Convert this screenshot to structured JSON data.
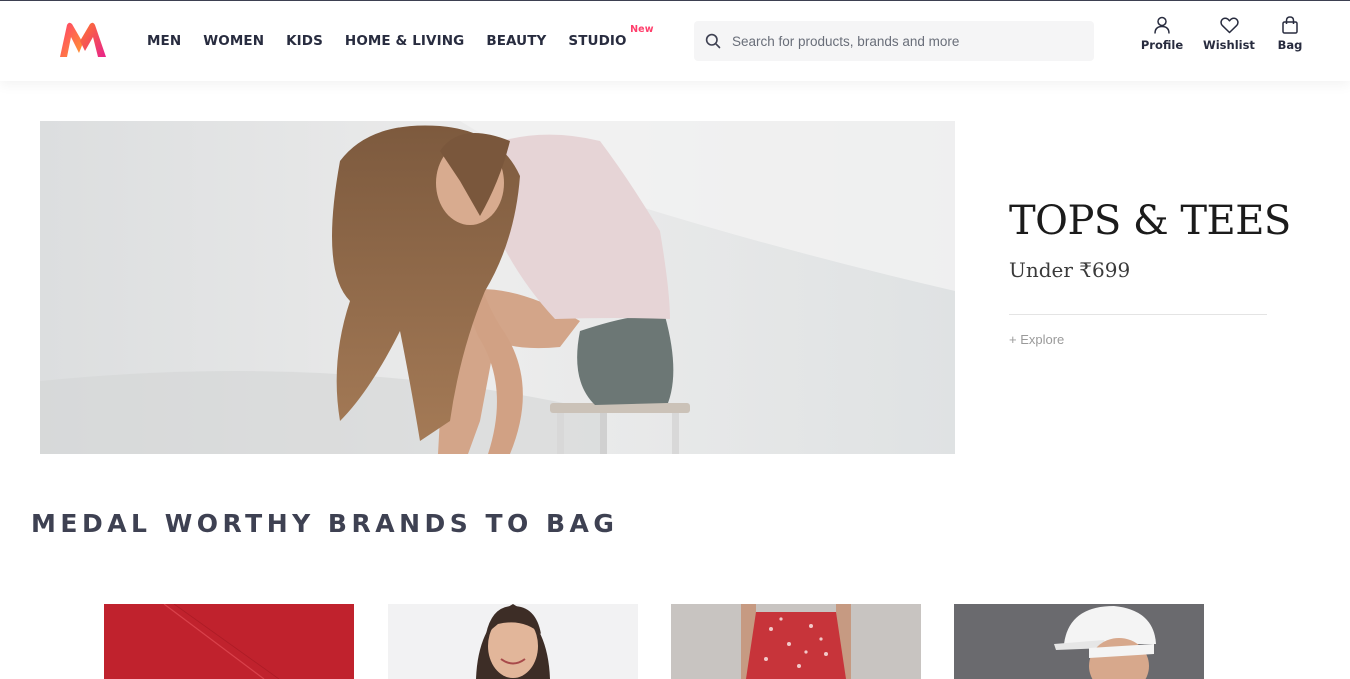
{
  "header": {
    "logo": {
      "icon": "myntra-logo-icon",
      "colors": [
        "#ff3f6c",
        "#ff7f23",
        "#e8228c"
      ]
    },
    "nav": [
      {
        "label": "MEN"
      },
      {
        "label": "WOMEN"
      },
      {
        "label": "KIDS"
      },
      {
        "label": "HOME & LIVING"
      },
      {
        "label": "BEAUTY"
      },
      {
        "label": "STUDIO",
        "badge": "New"
      }
    ],
    "search": {
      "icon": "search-icon",
      "placeholder": "Search for products, brands and more",
      "value": ""
    },
    "actions": [
      {
        "label": "Profile",
        "icon": "profile-icon"
      },
      {
        "label": "Wishlist",
        "icon": "heart-icon"
      },
      {
        "label": "Bag",
        "icon": "bag-icon"
      }
    ]
  },
  "hero": {
    "image": "woman-sitting-on-stool-photo",
    "promo": {
      "title": "TOPS & TEES",
      "subtitle": "Under ₹699",
      "cta": "+ Explore"
    }
  },
  "section": {
    "title": "MEDAL WORTHY BRANDS TO BAG",
    "cards": [
      {
        "image": "red-brand-banner"
      },
      {
        "image": "woman-smiling-model"
      },
      {
        "image": "red-floral-skirt-model"
      },
      {
        "image": "man-white-cap-model"
      }
    ]
  },
  "colors": {
    "accent": "#ff3f6c",
    "text": "#282c3f",
    "heading": "#3e4152",
    "search_bg": "#f5f5f6"
  }
}
